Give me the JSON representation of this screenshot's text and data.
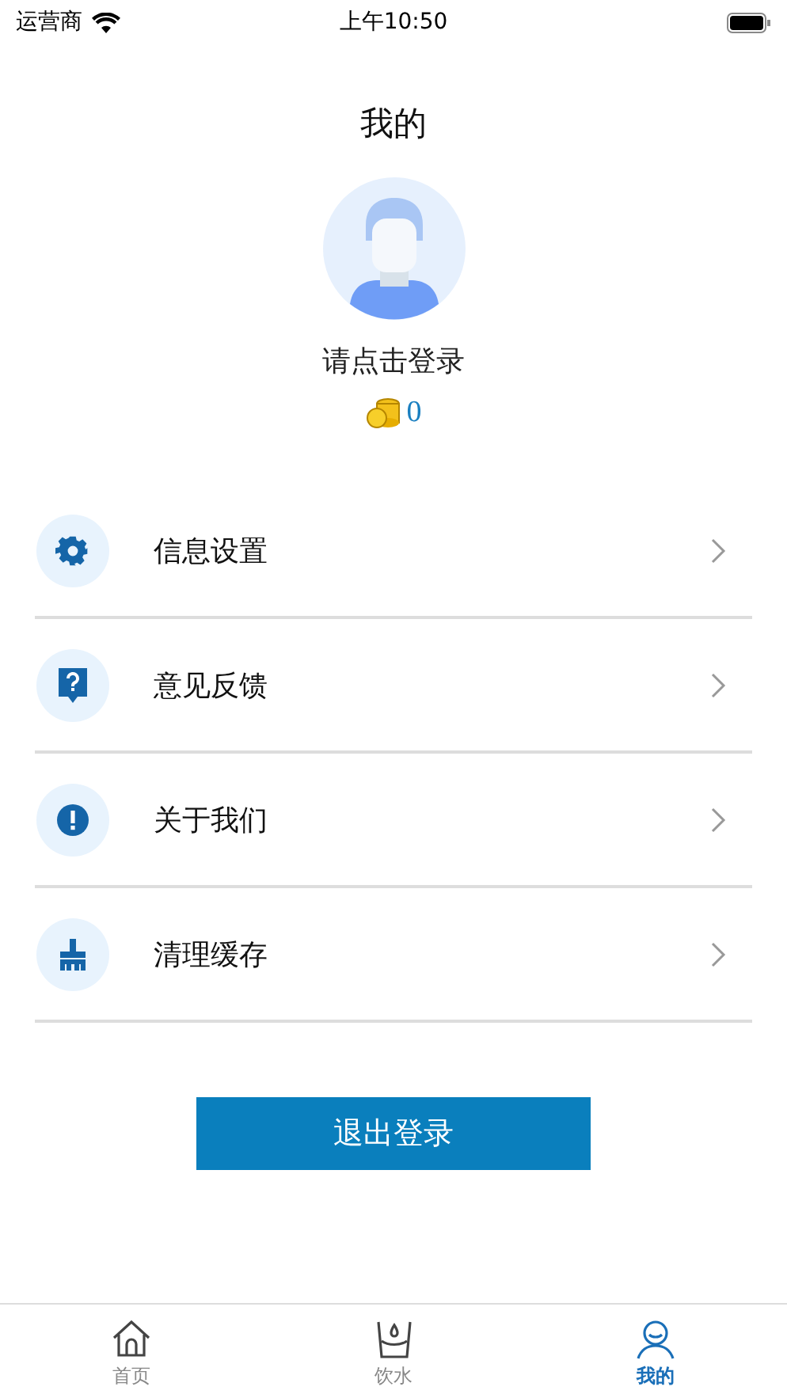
{
  "status_bar": {
    "carrier": "运营商",
    "time": "上午10:50"
  },
  "title": "我的",
  "profile": {
    "login_prompt": "请点击登录",
    "coins": "0"
  },
  "menu": [
    {
      "kind": "settings",
      "label": "信息设置"
    },
    {
      "kind": "feedback",
      "label": "意见反馈"
    },
    {
      "kind": "about",
      "label": "关于我们"
    },
    {
      "kind": "cache",
      "label": "清理缓存"
    }
  ],
  "logout_button": "退出登录",
  "tabs": [
    {
      "kind": "home",
      "label": "首页",
      "selected": false
    },
    {
      "kind": "water",
      "label": "饮水",
      "selected": false
    },
    {
      "kind": "me",
      "label": "我的",
      "selected": true
    }
  ]
}
